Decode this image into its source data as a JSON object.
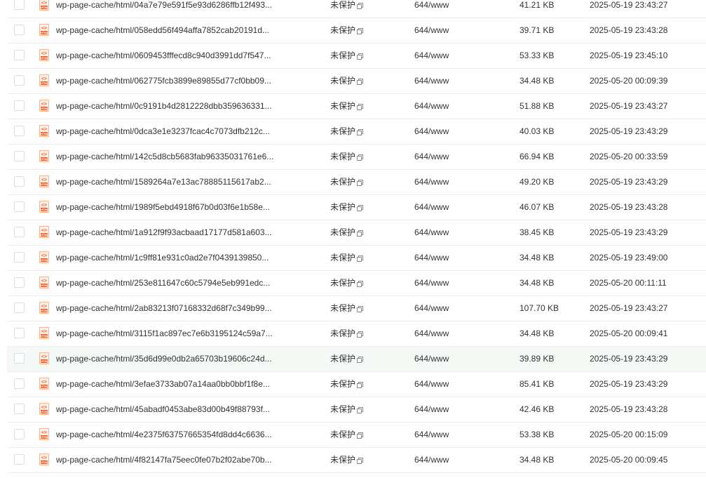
{
  "columns": {
    "icon": "html-file-icon",
    "icon_code": "<>",
    "icon_band": "HTML"
  },
  "files": [
    {
      "name": "wp-page-cache/html/04a7e79e591f5e93d6286ffb12f493...",
      "protect": "未保护",
      "perm": "644/www",
      "size": "41.21 KB",
      "mtime": "2025-05-19 23:43:27"
    },
    {
      "name": "wp-page-cache/html/058edd56f494affa7852cab20191d...",
      "protect": "未保护",
      "perm": "644/www",
      "size": "39.71 KB",
      "mtime": "2025-05-19 23:43:28"
    },
    {
      "name": "wp-page-cache/html/0609453fffecd8c940d3991dd7f547...",
      "protect": "未保护",
      "perm": "644/www",
      "size": "53.33 KB",
      "mtime": "2025-05-19 23:45:10"
    },
    {
      "name": "wp-page-cache/html/062775fcb3899e89855d77cf0bb09...",
      "protect": "未保护",
      "perm": "644/www",
      "size": "34.48 KB",
      "mtime": "2025-05-20 00:09:39"
    },
    {
      "name": "wp-page-cache/html/0c9191b4d2812228dbb359636331...",
      "protect": "未保护",
      "perm": "644/www",
      "size": "51.88 KB",
      "mtime": "2025-05-19 23:43:27"
    },
    {
      "name": "wp-page-cache/html/0dca3e1e3237fcac4c7073dfb212c...",
      "protect": "未保护",
      "perm": "644/www",
      "size": "40.03 KB",
      "mtime": "2025-05-19 23:43:29"
    },
    {
      "name": "wp-page-cache/html/142c5d8cb5683fab96335031761e6...",
      "protect": "未保护",
      "perm": "644/www",
      "size": "66.94 KB",
      "mtime": "2025-05-20 00:33:59"
    },
    {
      "name": "wp-page-cache/html/1589264a7e13ac78885115617ab2...",
      "protect": "未保护",
      "perm": "644/www",
      "size": "49.20 KB",
      "mtime": "2025-05-19 23:43:29"
    },
    {
      "name": "wp-page-cache/html/1989f5ebd4918f67b0d03f6e1b58e...",
      "protect": "未保护",
      "perm": "644/www",
      "size": "46.07 KB",
      "mtime": "2025-05-19 23:43:28"
    },
    {
      "name": "wp-page-cache/html/1a912f9f93acbaad17177d581a603...",
      "protect": "未保护",
      "perm": "644/www",
      "size": "38.45 KB",
      "mtime": "2025-05-19 23:43:29"
    },
    {
      "name": "wp-page-cache/html/1c9ff81e931c0ad2e7f0439139850...",
      "protect": "未保护",
      "perm": "644/www",
      "size": "34.48 KB",
      "mtime": "2025-05-19 23:49:00"
    },
    {
      "name": "wp-page-cache/html/253e811647c60c5794e5eb991edc...",
      "protect": "未保护",
      "perm": "644/www",
      "size": "34.48 KB",
      "mtime": "2025-05-20 00:11:11"
    },
    {
      "name": "wp-page-cache/html/2ab83213f07168332d68f7c349b99...",
      "protect": "未保护",
      "perm": "644/www",
      "size": "107.70 KB",
      "mtime": "2025-05-19 23:43:27"
    },
    {
      "name": "wp-page-cache/html/3115f1ac897ec7e6b3195124c59a7...",
      "protect": "未保护",
      "perm": "644/www",
      "size": "34.48 KB",
      "mtime": "2025-05-20 00:09:41"
    },
    {
      "name": "wp-page-cache/html/35d6d99e0db2a65703b19606c24d...",
      "protect": "未保护",
      "perm": "644/www",
      "size": "39.89 KB",
      "mtime": "2025-05-19 23:43:29"
    },
    {
      "name": "wp-page-cache/html/3efae3733ab07a14aa0bb0bbf1f8e...",
      "protect": "未保护",
      "perm": "644/www",
      "size": "85.41 KB",
      "mtime": "2025-05-19 23:43:29"
    },
    {
      "name": "wp-page-cache/html/45abadf0453abe83d00b49f88793f...",
      "protect": "未保护",
      "perm": "644/www",
      "size": "42.46 KB",
      "mtime": "2025-05-19 23:43:28"
    },
    {
      "name": "wp-page-cache/html/4e2375f63757665354fd8dd4c6636...",
      "protect": "未保护",
      "perm": "644/www",
      "size": "53.38 KB",
      "mtime": "2025-05-20 00:15:09"
    },
    {
      "name": "wp-page-cache/html/4f82147fa75eec0fe07b2f02abe70b...",
      "protect": "未保护",
      "perm": "644/www",
      "size": "34.48 KB",
      "mtime": "2025-05-20 00:09:45"
    }
  ],
  "hover_row_index": 14,
  "colors": {
    "border": "#ebeef5",
    "hover": "#f5f9f6",
    "icon_accent": "#e8622c"
  }
}
